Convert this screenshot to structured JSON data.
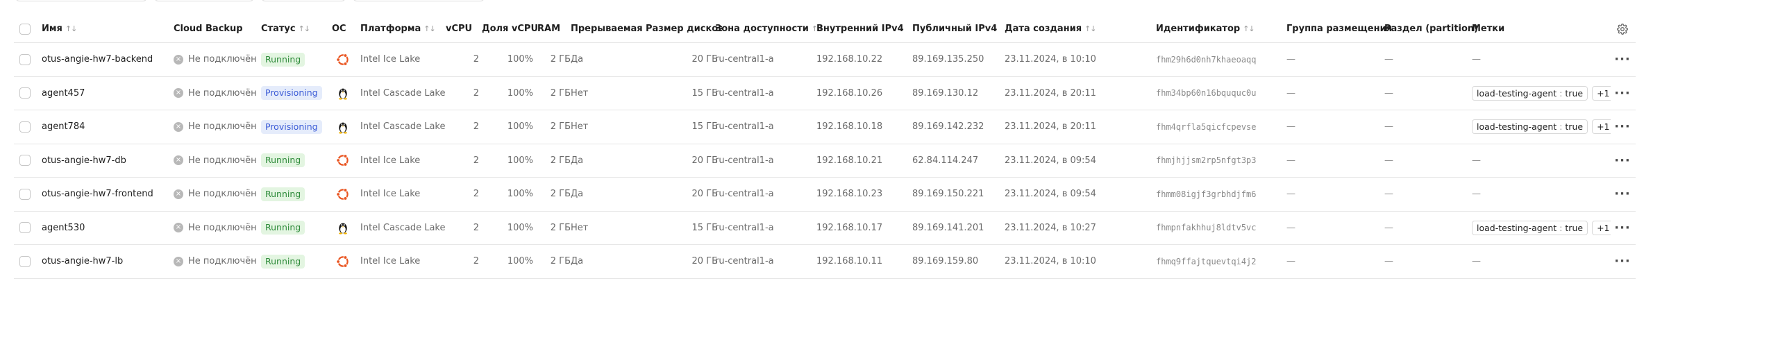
{
  "columns": {
    "name": "Имя",
    "backup": "Cloud Backup",
    "status": "Статус",
    "os": "ОС",
    "platform": "Платформа",
    "vcpu": "vCPU",
    "vcpu_share": "Доля vCPU",
    "ram": "RAM",
    "preemptible": "Прерываемая",
    "disk": "Размер дисков",
    "zone": "Зона доступности",
    "ipv4": "Внутренний IPv4",
    "public_ipv4": "Публичный IPv4",
    "created": "Дата создания",
    "id": "Идентификатор",
    "placement": "Группа размещения",
    "partition": "Раздел (partition)",
    "labels": "Метки"
  },
  "icons": {
    "sort": "sort-arrows-icon",
    "settings": "gear-icon",
    "backup": "close-circle-icon",
    "more": "more-horizontal-icon",
    "os_ubuntu": "ubuntu-icon",
    "os_linux": "linux-tux-icon"
  },
  "colors": {
    "running_bg": "#e3f5e1",
    "running_text": "#2e8b3a",
    "provisioning_bg": "#e5ecfb",
    "provisioning_text": "#3b5bd6",
    "ubuntu": "#e95420"
  },
  "rows": [
    {
      "name": "otus-angie-hw7-backend",
      "backup": "Не подключён",
      "status": "Running",
      "status_type": "running",
      "os": "ubuntu",
      "platform": "Intel Ice Lake",
      "vcpu": "2",
      "vcpu_share": "100%",
      "ram": "2 ГБ",
      "preemptible": "Да",
      "disk": "20 ГБ",
      "zone": "ru-central1-a",
      "ipv4": "192.168.10.22",
      "public_ipv4": "89.169.135.250",
      "created": "23.11.2024, в 10:10",
      "id": "fhm29h6d0nh7khaeoaqq",
      "placement": "—",
      "partition": "—",
      "label_key": "",
      "label_value": "",
      "label_more": "",
      "labels_empty": "—"
    },
    {
      "name": "agent457",
      "backup": "Не подключён",
      "status": "Provisioning",
      "status_type": "provisioning",
      "os": "linux",
      "platform": "Intel Cascade Lake",
      "vcpu": "2",
      "vcpu_share": "100%",
      "ram": "2 ГБ",
      "preemptible": "Нет",
      "disk": "15 ГБ",
      "zone": "ru-central1-a",
      "ipv4": "192.168.10.26",
      "public_ipv4": "89.169.130.12",
      "created": "23.11.2024, в 20:11",
      "id": "fhm34bp60n16bququc0u",
      "placement": "—",
      "partition": "—",
      "label_key": "load-testing-agent",
      "label_value": "true",
      "label_more": "+1",
      "labels_empty": ""
    },
    {
      "name": "agent784",
      "backup": "Не подключён",
      "status": "Provisioning",
      "status_type": "provisioning",
      "os": "linux",
      "platform": "Intel Cascade Lake",
      "vcpu": "2",
      "vcpu_share": "100%",
      "ram": "2 ГБ",
      "preemptible": "Нет",
      "disk": "15 ГБ",
      "zone": "ru-central1-a",
      "ipv4": "192.168.10.18",
      "public_ipv4": "89.169.142.232",
      "created": "23.11.2024, в 20:11",
      "id": "fhm4qrfla5qicfcpevse",
      "placement": "—",
      "partition": "—",
      "label_key": "load-testing-agent",
      "label_value": "true",
      "label_more": "+1",
      "labels_empty": ""
    },
    {
      "name": "otus-angie-hw7-db",
      "backup": "Не подключён",
      "status": "Running",
      "status_type": "running",
      "os": "ubuntu",
      "platform": "Intel Ice Lake",
      "vcpu": "2",
      "vcpu_share": "100%",
      "ram": "2 ГБ",
      "preemptible": "Да",
      "disk": "20 ГБ",
      "zone": "ru-central1-a",
      "ipv4": "192.168.10.21",
      "public_ipv4": "62.84.114.247",
      "created": "23.11.2024, в 09:54",
      "id": "fhmjhjjsm2rp5nfgt3p3",
      "placement": "—",
      "partition": "—",
      "label_key": "",
      "label_value": "",
      "label_more": "",
      "labels_empty": "—"
    },
    {
      "name": "otus-angie-hw7-frontend",
      "backup": "Не подключён",
      "status": "Running",
      "status_type": "running",
      "os": "ubuntu",
      "platform": "Intel Ice Lake",
      "vcpu": "2",
      "vcpu_share": "100%",
      "ram": "2 ГБ",
      "preemptible": "Да",
      "disk": "20 ГБ",
      "zone": "ru-central1-a",
      "ipv4": "192.168.10.23",
      "public_ipv4": "89.169.150.221",
      "created": "23.11.2024, в 09:54",
      "id": "fhmm08igjf3grbhdjfm6",
      "placement": "—",
      "partition": "—",
      "label_key": "",
      "label_value": "",
      "label_more": "",
      "labels_empty": "—"
    },
    {
      "name": "agent530",
      "backup": "Не подключён",
      "status": "Running",
      "status_type": "running",
      "os": "linux",
      "platform": "Intel Cascade Lake",
      "vcpu": "2",
      "vcpu_share": "100%",
      "ram": "2 ГБ",
      "preemptible": "Нет",
      "disk": "15 ГБ",
      "zone": "ru-central1-a",
      "ipv4": "192.168.10.17",
      "public_ipv4": "89.169.141.201",
      "created": "23.11.2024, в 10:27",
      "id": "fhmpnfakhhuj8ldtv5vc",
      "placement": "—",
      "partition": "—",
      "label_key": "load-testing-agent",
      "label_value": "true",
      "label_more": "+1",
      "labels_empty": ""
    },
    {
      "name": "otus-angie-hw7-lb",
      "backup": "Не подключён",
      "status": "Running",
      "status_type": "running",
      "os": "ubuntu",
      "platform": "Intel Ice Lake",
      "vcpu": "2",
      "vcpu_share": "100%",
      "ram": "2 ГБ",
      "preemptible": "Да",
      "disk": "20 ГБ",
      "zone": "ru-central1-a",
      "ipv4": "192.168.10.11",
      "public_ipv4": "89.169.159.80",
      "created": "23.11.2024, в 10:10",
      "id": "fhmq9ffajtquevtqi4j2",
      "placement": "—",
      "partition": "—",
      "label_key": "",
      "label_value": "",
      "label_more": "",
      "labels_empty": "—"
    }
  ]
}
